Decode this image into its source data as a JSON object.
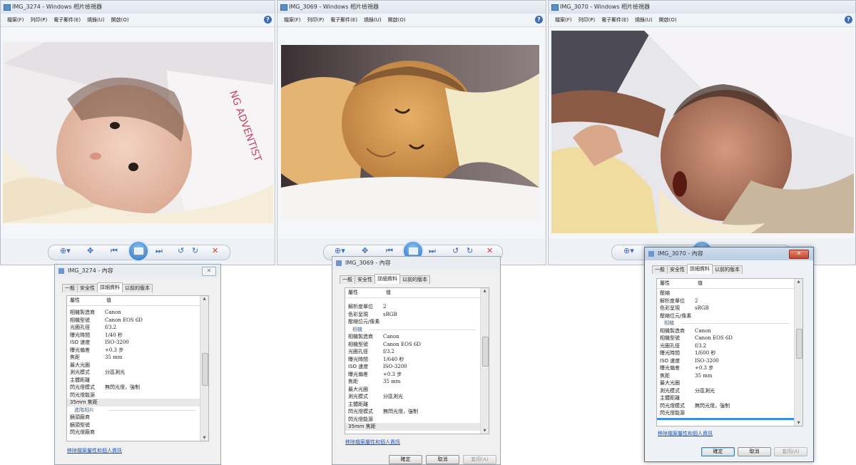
{
  "viewers": [
    {
      "title": "IMG_3274 - Windows 相片檢視器"
    },
    {
      "title": "IMG_3069 - Windows 相片檢視器"
    },
    {
      "title": "IMG_3070 - Windows 相片檢視器"
    }
  ],
  "menu": {
    "file": "檔案(F)",
    "print": "列印(P)",
    "email": "電子郵件(E)",
    "burn": "燒錄(U)",
    "open": "開啟(O)",
    "help": "?"
  },
  "props_common": {
    "tabs": [
      "一般",
      "安全性",
      "詳細資料",
      "以前的版本"
    ],
    "col_property": "屬性",
    "col_value": "值",
    "remove_link": "移除檔案屬性和個人資訊",
    "ok": "確定",
    "cancel": "取消",
    "apply": "套用(A)"
  },
  "dialogs": [
    {
      "title": "IMG_3274 - 內容",
      "rows": [
        {
          "k": "相機製造商",
          "v": "Canon"
        },
        {
          "k": "相機型號",
          "v": "Canon EOS 6D"
        },
        {
          "k": "光圈孔徑",
          "v": "f/3.2"
        },
        {
          "k": "曝光時間",
          "v": "1/40 秒"
        },
        {
          "k": "ISO 速度",
          "v": "ISO-3200"
        },
        {
          "k": "曝光偏差",
          "v": "+0.3 步"
        },
        {
          "k": "焦距",
          "v": "35 mm"
        },
        {
          "k": "最大光圈",
          "v": ""
        },
        {
          "k": "測光模式",
          "v": "分區測光"
        },
        {
          "k": "主體距離",
          "v": ""
        },
        {
          "k": "閃光燈模式",
          "v": "無閃光燈，強制"
        },
        {
          "k": "閃光燈能源",
          "v": ""
        },
        {
          "k": "35mm 焦距",
          "v": ""
        }
      ],
      "section": "進階相片",
      "rows2": [
        {
          "k": "鏡頭廠商",
          "v": ""
        },
        {
          "k": "鏡頭型號",
          "v": ""
        },
        {
          "k": "閃光燈廠商",
          "v": ""
        }
      ]
    },
    {
      "title": "IMG_3069 - 內容",
      "rows_top": [
        {
          "k": "解析度單位",
          "v": "2"
        },
        {
          "k": "色彩呈現",
          "v": "sRGB"
        },
        {
          "k": "壓縮位元/像素",
          "v": ""
        }
      ],
      "section": "相機",
      "rows": [
        {
          "k": "相機製造商",
          "v": "Canon"
        },
        {
          "k": "相機型號",
          "v": "Canon EOS 6D"
        },
        {
          "k": "光圈孔徑",
          "v": "f/3.2"
        },
        {
          "k": "曝光時間",
          "v": "1/640 秒"
        },
        {
          "k": "ISO 速度",
          "v": "ISO-3200"
        },
        {
          "k": "曝光偏差",
          "v": "+0.3 步"
        },
        {
          "k": "焦距",
          "v": "35 mm"
        },
        {
          "k": "最大光圈",
          "v": ""
        },
        {
          "k": "測光模式",
          "v": "分區測光"
        },
        {
          "k": "主體距離",
          "v": ""
        },
        {
          "k": "閃光燈模式",
          "v": "無閃光燈，強制"
        },
        {
          "k": "閃光燈能源",
          "v": ""
        },
        {
          "k": "35mm 焦距",
          "v": ""
        }
      ]
    },
    {
      "title": "IMG_3070 - 內容",
      "rows_top": [
        {
          "k": "壓縮",
          "v": ""
        },
        {
          "k": "解析度單位",
          "v": "2"
        },
        {
          "k": "色彩呈現",
          "v": "sRGB"
        },
        {
          "k": "壓縮位元/像素",
          "v": ""
        }
      ],
      "section": "相機",
      "rows": [
        {
          "k": "相機製造商",
          "v": "Canon"
        },
        {
          "k": "相機型號",
          "v": "Canon EOS 6D"
        },
        {
          "k": "光圈孔徑",
          "v": "f/3.2"
        },
        {
          "k": "曝光時間",
          "v": "1/600 秒"
        },
        {
          "k": "ISO 速度",
          "v": "ISO-3200"
        },
        {
          "k": "曝光偏差",
          "v": "+0.3 步"
        },
        {
          "k": "焦距",
          "v": "35 mm"
        },
        {
          "k": "最大光圈",
          "v": ""
        },
        {
          "k": "測光模式",
          "v": "分區測光"
        },
        {
          "k": "主體距離",
          "v": ""
        },
        {
          "k": "閃光燈模式",
          "v": "無閃光燈，強制"
        },
        {
          "k": "閃光燈能源",
          "v": ""
        }
      ]
    }
  ]
}
